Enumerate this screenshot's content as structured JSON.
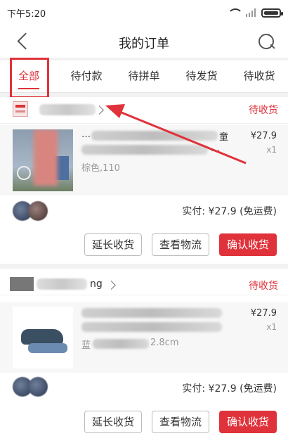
{
  "status_bar": {
    "time": "下午5:20"
  },
  "nav": {
    "title": "我的订单"
  },
  "tabs": [
    {
      "label": "全部",
      "active": true
    },
    {
      "label": "待付款"
    },
    {
      "label": "待拼单"
    },
    {
      "label": "待发货"
    },
    {
      "label": "待收货"
    }
  ],
  "orders": [
    {
      "shop_name": "",
      "status": "待收货",
      "product": {
        "title_line1": "…",
        "title_suffix1": "童",
        "title_suffix2": "…",
        "spec": "棕色,110",
        "price": "¥27.9",
        "qty": "x1"
      },
      "summary": "实付: ¥27.9 (免运费)",
      "buttons": {
        "extend": "延长收货",
        "logistics": "查看物流",
        "confirm": "确认收货"
      }
    },
    {
      "shop_name": "ng",
      "status": "待收货",
      "product": {
        "spec_prefix": "蓝",
        "spec_suffix": "2.8cm",
        "price": "¥27.9",
        "qty": "x1"
      },
      "summary": "实付: ¥27.9 (免运费)",
      "buttons": {
        "extend": "延长收货",
        "logistics": "查看物流",
        "confirm": "确认收货"
      }
    }
  ],
  "colors": {
    "accent": "#e0323a"
  }
}
